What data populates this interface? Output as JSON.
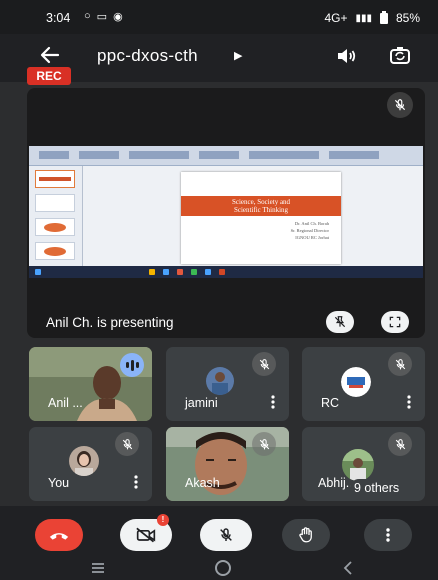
{
  "status_bar": {
    "time": "3:04",
    "network": "4G+",
    "battery": "85%",
    "icons": [
      "o-icon",
      "message-icon",
      "chrome-icon",
      "signal-icon",
      "battery-icon"
    ]
  },
  "header": {
    "meeting_code": "ppc-dxos-cth",
    "rec_label": "REC"
  },
  "presentation": {
    "presenting_label": "Anil Ch. is presenting",
    "slide_title_line1": "Science, Society and",
    "slide_title_line2": "Scientific Thinking",
    "slide_author_line1": "Dr. Anil Ch. Borah",
    "slide_author_line2": "Sr. Regional Director",
    "slide_author_line3": "IGNOU RC Jorhat"
  },
  "participants": [
    {
      "name": "Anil ...",
      "muted": false,
      "speaking": true
    },
    {
      "name": "jamini",
      "muted": true
    },
    {
      "name": "RC",
      "muted": true
    },
    {
      "name": "You",
      "muted": true
    },
    {
      "name": "Akash",
      "muted": true
    },
    {
      "name": "Abhij...",
      "muted": true,
      "others_label": "9 others"
    }
  ],
  "controls": {
    "camera_badge": "!",
    "buttons": [
      "end-call",
      "camera-off",
      "mic-off",
      "raise-hand",
      "more-options"
    ]
  },
  "colors": {
    "end_call": "#ea4335",
    "rec": "#d93025",
    "speaking": "#8ab4f8",
    "tile": "#3c4043",
    "background": "#2c2d2f"
  }
}
